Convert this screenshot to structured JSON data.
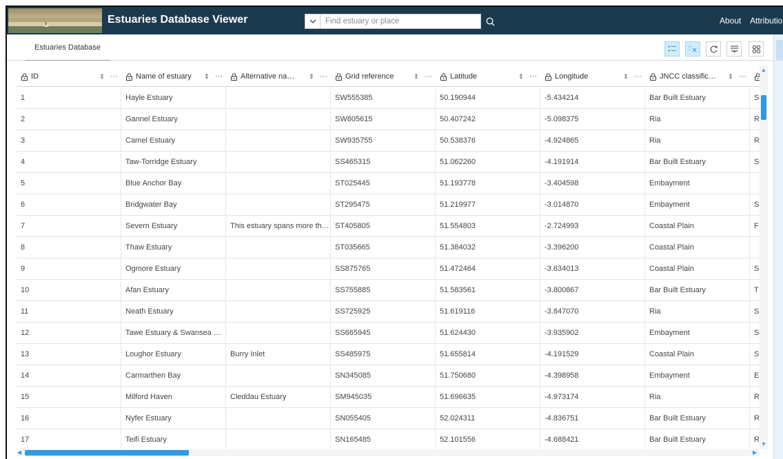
{
  "app": {
    "title": "Estuaries Database Viewer"
  },
  "search": {
    "placeholder": "Find estuary or place"
  },
  "header_links": {
    "about": "About",
    "attribution": "Attribution"
  },
  "tab": {
    "label": "Estuaries Database"
  },
  "toolbar": {
    "icons": [
      "show-selected-icon",
      "clear-selection-icon",
      "refresh-icon",
      "filter-icon",
      "column-options-icon"
    ]
  },
  "columns": [
    {
      "label": "ID"
    },
    {
      "label": "Name of estuary"
    },
    {
      "label": "Alternative na…"
    },
    {
      "label": "Grid reference"
    },
    {
      "label": "Latitude"
    },
    {
      "label": "Longitude"
    },
    {
      "label": "JNCC classific…"
    },
    {
      "label": ""
    }
  ],
  "rows": [
    [
      "1",
      "Hayle Estuary",
      "",
      "SW555385",
      "50.190944",
      "-5.434214",
      "Bar Built Estuary",
      "S"
    ],
    [
      "2",
      "Gannel Estuary",
      "",
      "SW805615",
      "50.407242",
      "-5.098375",
      "Ria",
      "R"
    ],
    [
      "3",
      "Camel Estuary",
      "",
      "SW935755",
      "50.538376",
      "-4.924865",
      "Ria",
      "R"
    ],
    [
      "4",
      "Taw-Torridge Estuary",
      "",
      "SS465315",
      "51.062260",
      "-4.191914",
      "Bar Built Estuary",
      "S"
    ],
    [
      "5",
      "Blue Anchor Bay",
      "",
      "ST025445",
      "51.193778",
      "-3.404598",
      "Embayment",
      ""
    ],
    [
      "6",
      "Bridgwater Bay",
      "",
      "ST295475",
      "51.219977",
      "-3.014870",
      "Embayment",
      "S"
    ],
    [
      "7",
      "Severn Estuary",
      "This estuary spans more th…",
      "ST405805",
      "51.554803",
      "-2.724993",
      "Coastal Plain",
      "F"
    ],
    [
      "8",
      "Thaw Estuary",
      "",
      "ST035665",
      "51.384032",
      "-3.396200",
      "Coastal Plain",
      ""
    ],
    [
      "9",
      "Ogmore Estuary",
      "",
      "SS875765",
      "51.472464",
      "-3.634013",
      "Coastal Plain",
      "S"
    ],
    [
      "10",
      "Afan Estuary",
      "",
      "SS755885",
      "51.583561",
      "-3.800867",
      "Bar Built Estuary",
      "T"
    ],
    [
      "11",
      "Neath Estuary",
      "",
      "SS725925",
      "51.619116",
      "-3.847070",
      "Ria",
      "S"
    ],
    [
      "12",
      "Tawe Estuary & Swansea Bay",
      "",
      "SS665945",
      "51.624430",
      "-3.935902",
      "Embayment",
      "S"
    ],
    [
      "13",
      "Loughor Estuary",
      "Burry Inlet",
      "SS485975",
      "51.655814",
      "-4.191529",
      "Coastal Plain",
      "S"
    ],
    [
      "14",
      "Carmarthen Bay",
      "",
      "SN345085",
      "51.750680",
      "-4.398958",
      "Embayment",
      "E"
    ],
    [
      "15",
      "Milford Haven",
      "Cleddau Estuary",
      "SM945035",
      "51.696635",
      "-4.973174",
      "Ria",
      "R"
    ],
    [
      "16",
      "Nyfer Estuary",
      "",
      "SN055405",
      "52.024311",
      "-4.836751",
      "Bar Built Estuary",
      "R"
    ],
    [
      "17",
      "Teifi Estuary",
      "",
      "SN165485",
      "52.101556",
      "-4.688421",
      "Bar Built Estuary",
      "R"
    ]
  ],
  "colors": {
    "header_bg": "#1b3a4e",
    "accent": "#2f9be0",
    "active_tool_bg": "#d2ecfa"
  }
}
